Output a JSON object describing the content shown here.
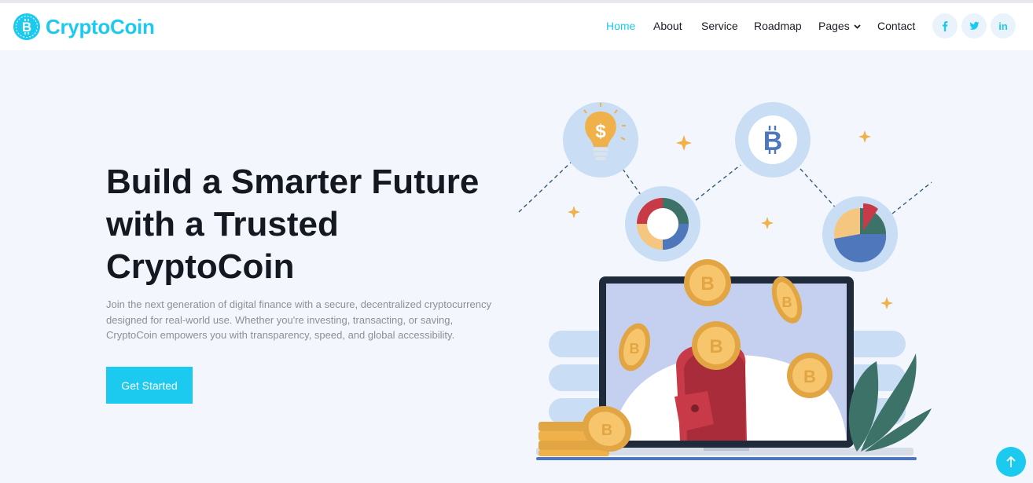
{
  "brand": {
    "name": "CryptoCoin"
  },
  "nav": {
    "items": [
      {
        "label": "Home",
        "active": true
      },
      {
        "label": "About"
      },
      {
        "label": "Service"
      },
      {
        "label": "Roadmap"
      },
      {
        "label": "Pages",
        "has_dropdown": true
      },
      {
        "label": "Contact"
      }
    ]
  },
  "social": [
    {
      "icon": "facebook-icon"
    },
    {
      "icon": "twitter-icon"
    },
    {
      "icon": "linkedin-icon",
      "glyph": "in"
    }
  ],
  "hero": {
    "title_lines": [
      "Build a Smarter Future",
      "with a Trusted",
      "CryptoCoin"
    ],
    "description": "Join the next generation of digital finance with a secure, decentralized cryptocurrency designed for real-world use. Whether you're investing, transacting, or saving, CryptoCoin empowers you with transparency, speed, and global accessibility.",
    "cta_label": "Get Started"
  },
  "colors": {
    "accent": "#1ccaf0",
    "background": "#f3f7fd",
    "heading": "#141821",
    "body_text": "#8a8f99",
    "coin": "#f0b04a",
    "wallet": "#c93a48"
  }
}
